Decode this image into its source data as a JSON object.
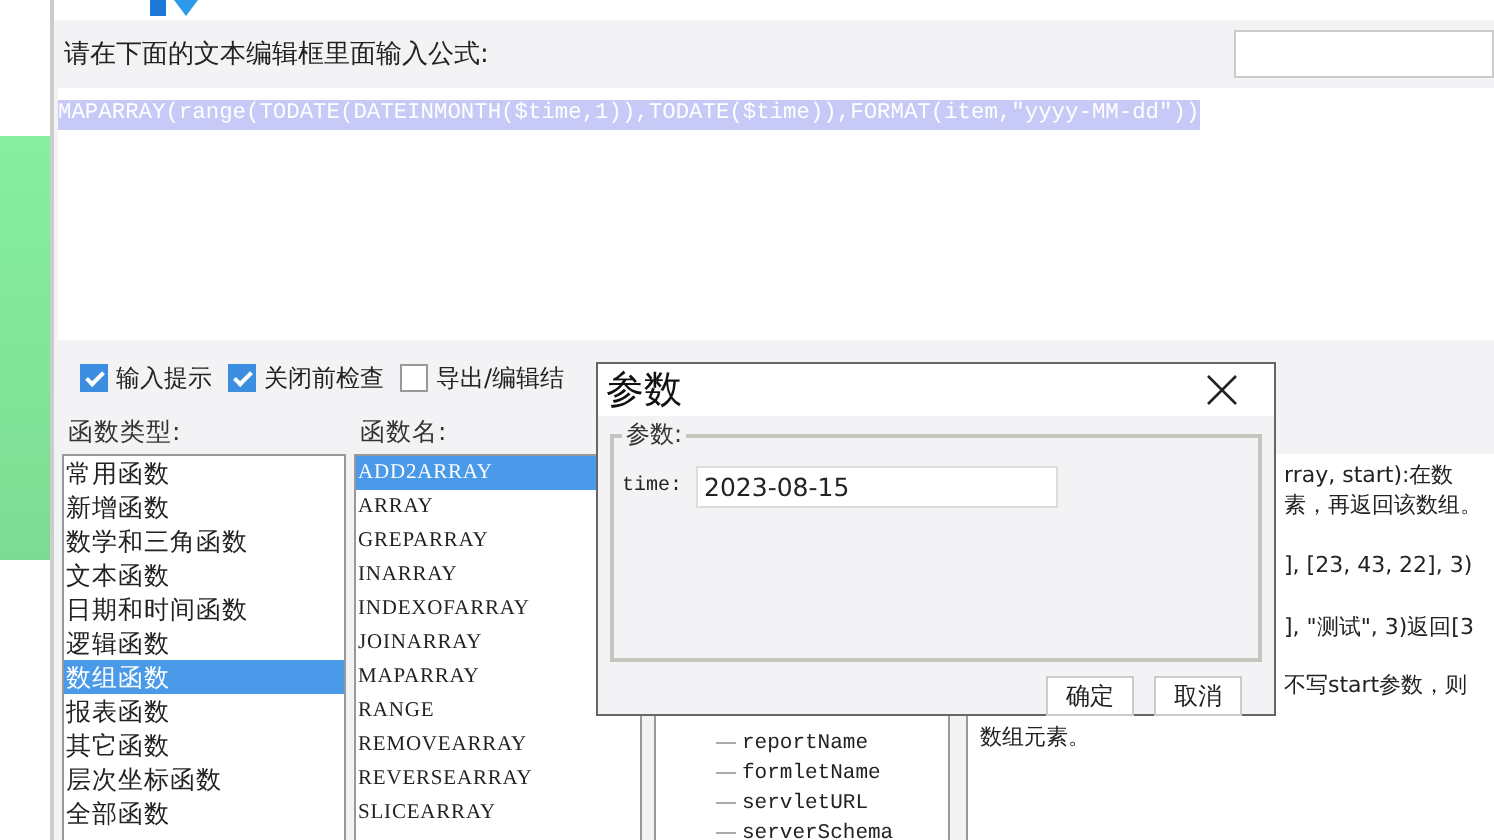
{
  "editor": {
    "prompt": "请在下面的文本编辑框里面输入公式:",
    "formula": "MAPARRAY(range(TODATE(DATEINMONTH($time,1)),TODATE($time)),FORMAT(item,\"yyyy-MM-dd\"))",
    "formula_selected": true
  },
  "options": [
    {
      "label": "输入提示",
      "checked": true
    },
    {
      "label": "关闭前检查",
      "checked": true
    },
    {
      "label": "导出/编辑结",
      "checked": false
    }
  ],
  "function_types": {
    "label": "函数类型:",
    "items": [
      {
        "label": "常用函数",
        "selected": false
      },
      {
        "label": "新增函数",
        "selected": false
      },
      {
        "label": "数学和三角函数",
        "selected": false
      },
      {
        "label": "文本函数",
        "selected": false
      },
      {
        "label": "日期和时间函数",
        "selected": false
      },
      {
        "label": "逻辑函数",
        "selected": false
      },
      {
        "label": "数组函数",
        "selected": true
      },
      {
        "label": "报表函数",
        "selected": false
      },
      {
        "label": "其它函数",
        "selected": false
      },
      {
        "label": "层次坐标函数",
        "selected": false
      },
      {
        "label": "全部函数",
        "selected": false
      }
    ]
  },
  "function_names": {
    "label": "函数名:",
    "items": [
      {
        "label": "ADD2ARRAY",
        "selected": true
      },
      {
        "label": "ARRAY",
        "selected": false
      },
      {
        "label": "GREPARRAY",
        "selected": false
      },
      {
        "label": "INARRAY",
        "selected": false
      },
      {
        "label": "INDEXOFARRAY",
        "selected": false
      },
      {
        "label": "JOINARRAY",
        "selected": false
      },
      {
        "label": "MAPARRAY",
        "selected": false
      },
      {
        "label": "RANGE",
        "selected": false
      },
      {
        "label": "REMOVEARRAY",
        "selected": false
      },
      {
        "label": "REVERSEARRAY",
        "selected": false
      },
      {
        "label": "SLICEARRAY",
        "selected": false
      }
    ]
  },
  "variables": [
    "reportName",
    "formletName",
    "servletURL",
    "serverSchema"
  ],
  "description": [
    "rray, start):在数",
    "素，再返回该数组。",
    "], [23, 43, 22], 3)",
    "], \"测试\", 3)返回[3",
    "不写start参数，则",
    "数组元素。"
  ],
  "dialog": {
    "title": "参数",
    "group": "参数:",
    "field_label": "time:",
    "field_value": "2023-08-15",
    "buttons": [
      "确定",
      "取消"
    ]
  }
}
